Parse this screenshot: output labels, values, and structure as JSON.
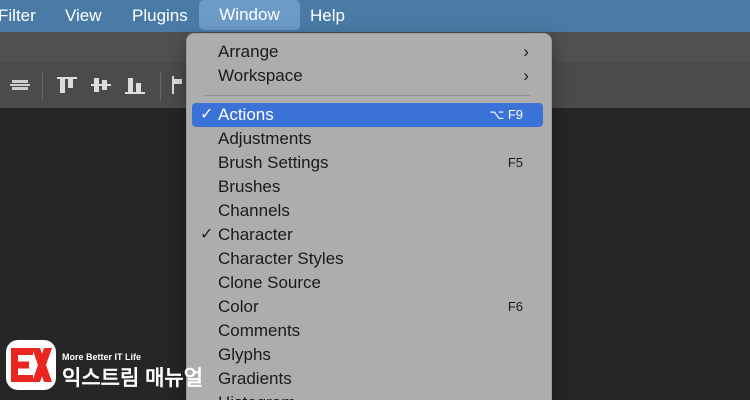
{
  "menubar": {
    "items": [
      "Filter",
      "View",
      "Plugins",
      "Window",
      "Help"
    ],
    "active": "Window",
    "bg": "#4a7ba6"
  },
  "menu": {
    "submenus": [
      {
        "label": "Arrange"
      },
      {
        "label": "Workspace"
      }
    ],
    "items": [
      {
        "label": "Actions",
        "shortcut": "⌥ F9",
        "checked": true,
        "selected": true
      },
      {
        "label": "Adjustments",
        "shortcut": "",
        "checked": false
      },
      {
        "label": "Brush Settings",
        "shortcut": "F5",
        "checked": false
      },
      {
        "label": "Brushes",
        "shortcut": "",
        "checked": false
      },
      {
        "label": "Channels",
        "shortcut": "",
        "checked": false
      },
      {
        "label": "Character",
        "shortcut": "",
        "checked": true
      },
      {
        "label": "Character Styles",
        "shortcut": "",
        "checked": false
      },
      {
        "label": "Clone Source",
        "shortcut": "",
        "checked": false
      },
      {
        "label": "Color",
        "shortcut": "F6",
        "checked": false
      },
      {
        "label": "Comments",
        "shortcut": "",
        "checked": false
      },
      {
        "label": "Glyphs",
        "shortcut": "",
        "checked": false
      },
      {
        "label": "Gradients",
        "shortcut": "",
        "checked": false
      },
      {
        "label": "Histogram",
        "shortcut": "",
        "checked": false
      }
    ],
    "check_glyph": "✓",
    "arrow_glyph": "›",
    "highlight": "#3a72d8"
  },
  "watermark": {
    "tagline": "More Better IT Life",
    "name": "익스트림 매뉴얼"
  }
}
